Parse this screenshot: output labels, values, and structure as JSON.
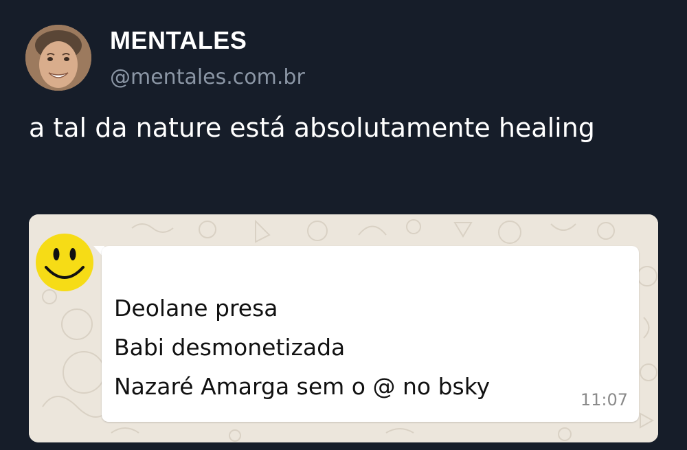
{
  "post": {
    "author": {
      "display_name": "MENTALES",
      "handle": "@mentales.com.br",
      "avatar_icon": "user-avatar-photo"
    },
    "text": "a tal da nature está absolutamente healing"
  },
  "embedded_chat": {
    "sender_avatar_icon": "smiley-face-icon",
    "message_lines": [
      "Deolane presa",
      "Babi desmonetizada",
      "Nazaré Amarga sem o @ no bsky"
    ],
    "time": "11:07"
  },
  "colors": {
    "background": "#161d29",
    "handle": "#8b96a5",
    "chat_wallpaper": "#ece6dc",
    "bubble": "#ffffff",
    "smiley": "#f6dc16"
  }
}
